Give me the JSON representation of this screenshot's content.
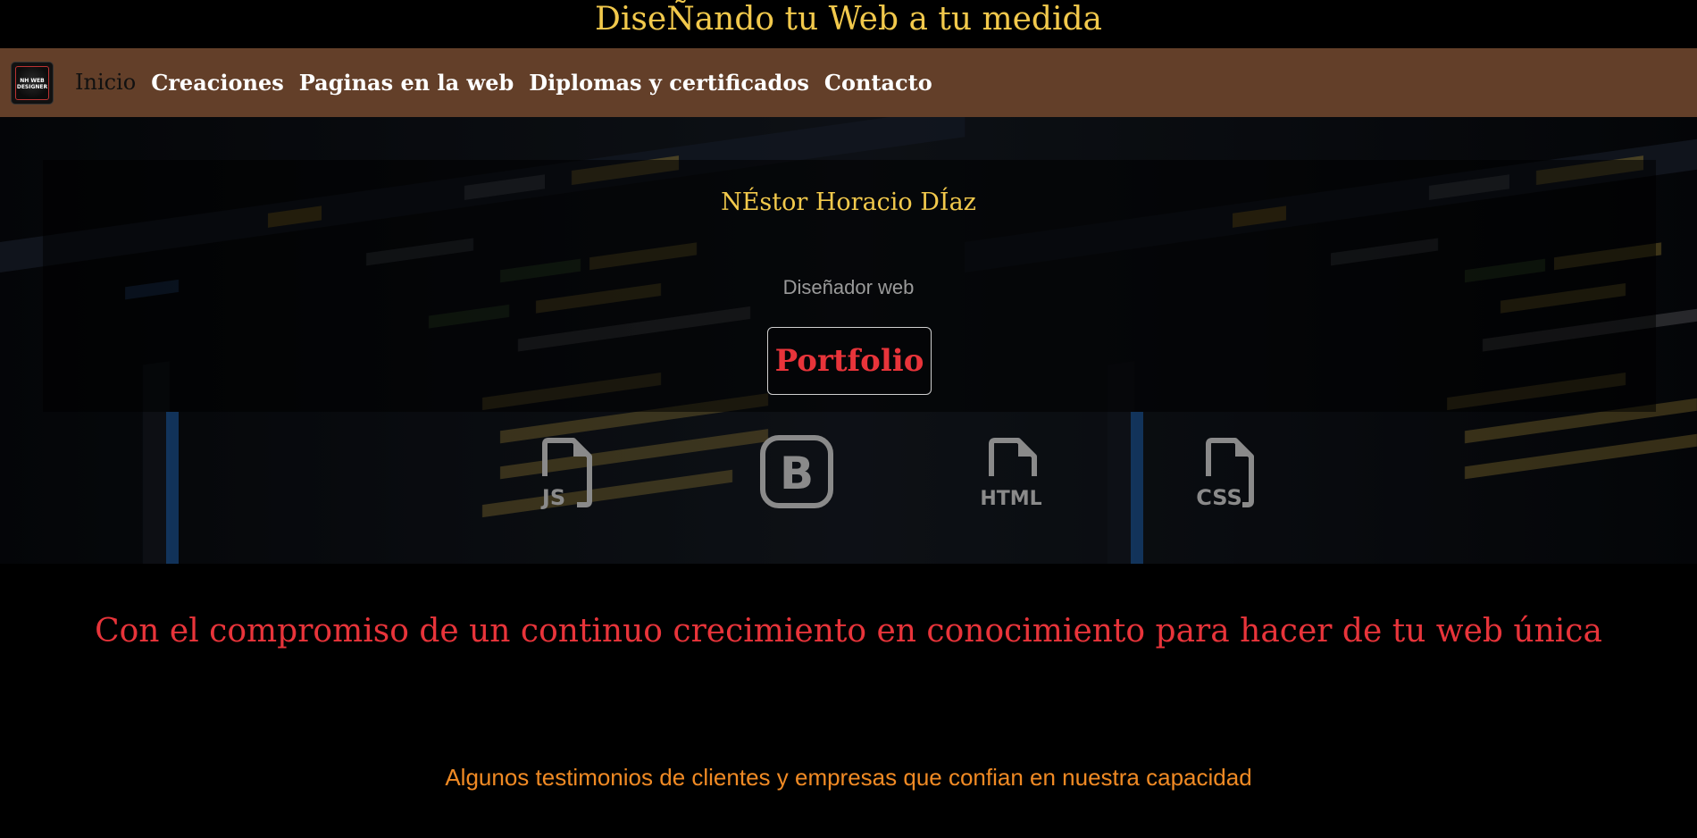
{
  "header": {
    "title": "DiseÑando tu Web a tu medida"
  },
  "logo": {
    "text": "NH WEB DESIGNER"
  },
  "nav": {
    "items": [
      {
        "label": "Inicio",
        "active": true
      },
      {
        "label": "Creaciones",
        "active": false
      },
      {
        "label": "Paginas en la web",
        "active": false
      },
      {
        "label": "Diplomas y certificados",
        "active": false
      },
      {
        "label": "Contacto",
        "active": false
      }
    ]
  },
  "hero": {
    "name": "NÉstor Horacio DÍaz",
    "role": "Diseñador web",
    "portfolio_label": "Portfolio",
    "tech_icons": [
      {
        "name": "javascript-icon",
        "label": "JS"
      },
      {
        "name": "bootstrap-icon",
        "label": "B"
      },
      {
        "name": "html-icon",
        "label": "HTML"
      },
      {
        "name": "css-icon",
        "label": "CSS"
      }
    ]
  },
  "commitment": {
    "text": "Con el compromiso de un continuo crecimiento en conocimiento para hacer de tu web única"
  },
  "testimonials": {
    "heading": "Algunos testimonios de clientes y empresas que confian en nuestra capacidad"
  },
  "colors": {
    "title_gold": "#f2c94c",
    "nav_brown": "#633f29",
    "accent_red": "#e8343a",
    "accent_orange": "#f08a24"
  }
}
